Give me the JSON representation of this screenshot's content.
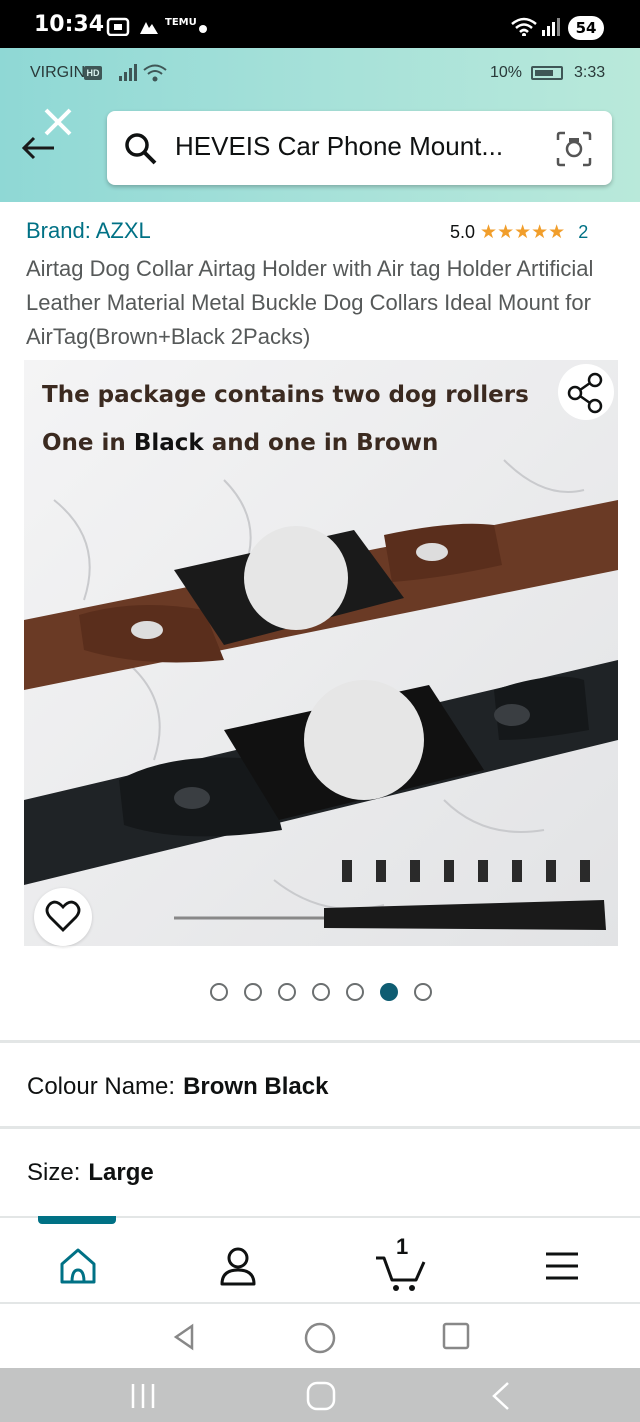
{
  "outer_status": {
    "time": "10:34",
    "battery": "54",
    "notif_text": "TEMU"
  },
  "inner_status": {
    "carrier": "VIRGIN",
    "hd": "HD",
    "battery_pct": "10%",
    "clock": "3:33"
  },
  "search": {
    "query": "HEVEIS Car Phone Mount..."
  },
  "product": {
    "brand": "Brand: AZXL",
    "rating_value": "5.0",
    "stars": "★★★★★",
    "rating_count": "2",
    "title": "Airtag Dog Collar Airtag Holder with Air tag Holder Artificial Leather Material Metal Buckle Dog Collars Ideal Mount for AirTag(Brown+Black 2Packs)",
    "image_text_line1": "The package contains two dog rollers",
    "image_text_line2_pre": "One in ",
    "image_text_line2_black": "Black",
    "image_text_line2_mid": " and one in ",
    "image_text_line2_brown": "Brown"
  },
  "carousel": {
    "count": 7,
    "active_index": 5
  },
  "options": {
    "colour_label": "Colour Name:",
    "colour_value": "Brown Black",
    "size_label": "Size:",
    "size_value": "Large"
  },
  "bottom_nav": {
    "cart_count": "1",
    "items": [
      "home-icon",
      "account-icon",
      "cart-icon",
      "menu-icon"
    ]
  },
  "colors": {
    "link": "#007185",
    "star": "#f19e2b",
    "active_dot": "#0f5d72"
  }
}
